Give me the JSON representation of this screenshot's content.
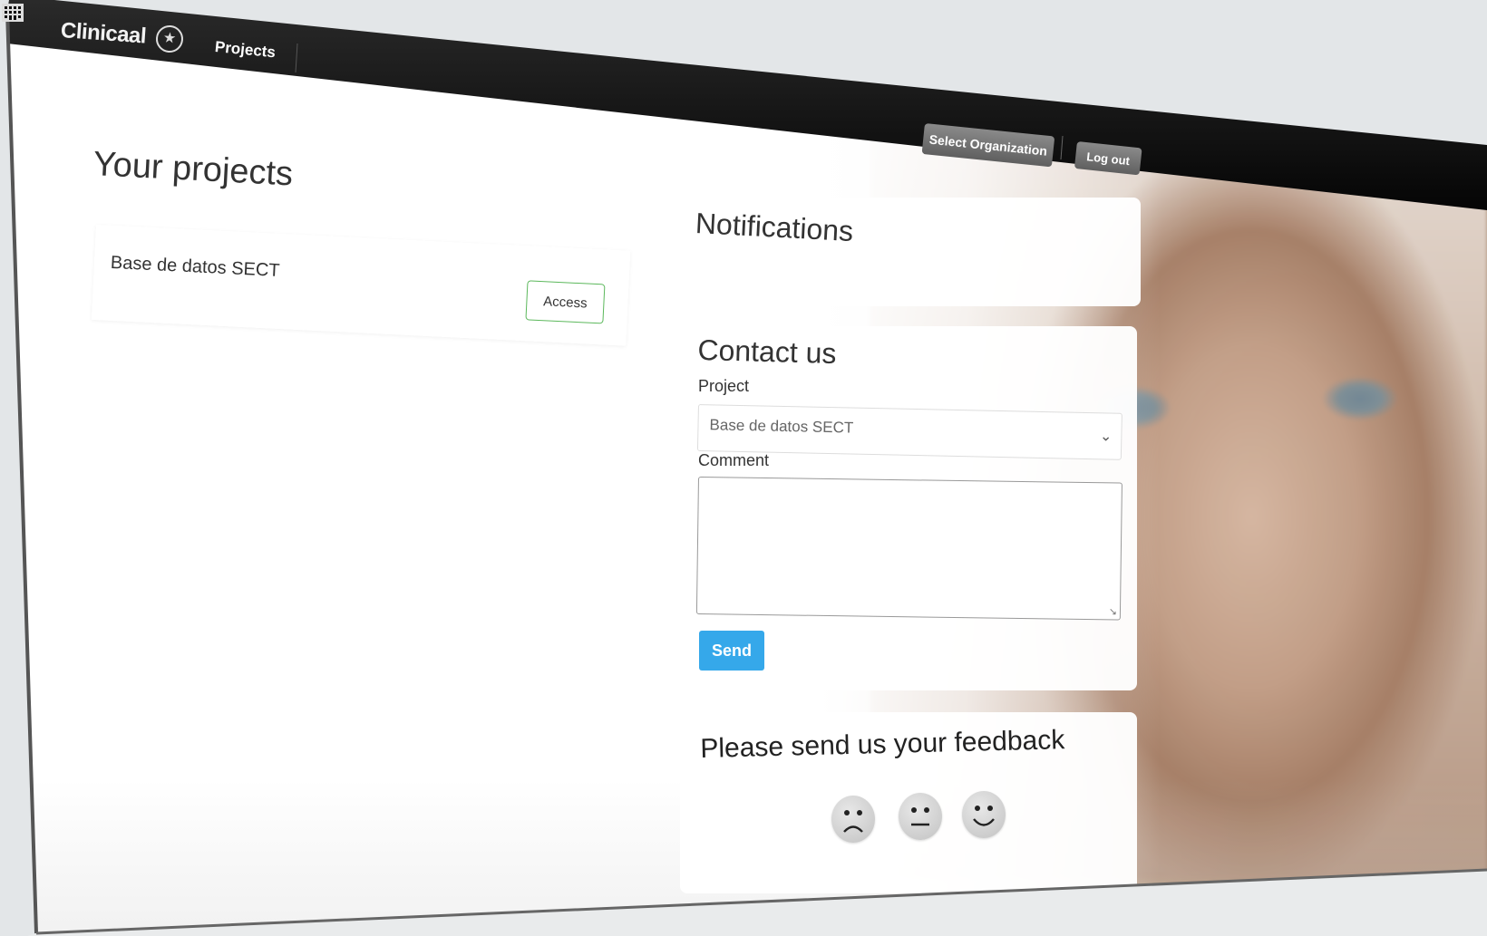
{
  "header": {
    "logo_text": "Clinicaal",
    "nav_projects": "Projects",
    "select_org_label": "Select Organization",
    "logout_label": "Log out"
  },
  "projects": {
    "title": "Your projects",
    "items": [
      {
        "name": "Base de datos SECT",
        "access_label": "Access"
      }
    ]
  },
  "notifications": {
    "title": "Notifications"
  },
  "contact": {
    "title": "Contact us",
    "project_label": "Project",
    "project_value": "Base de datos SECT",
    "comment_label": "Comment",
    "comment_value": "",
    "send_label": "Send"
  },
  "feedback": {
    "title": "Please send us your feedback",
    "options": [
      "sad-face-icon",
      "neutral-face-icon",
      "happy-face-icon"
    ]
  },
  "colors": {
    "topbar": "#111111",
    "send_button": "#35a8ea",
    "access_border": "#5cb85c"
  }
}
